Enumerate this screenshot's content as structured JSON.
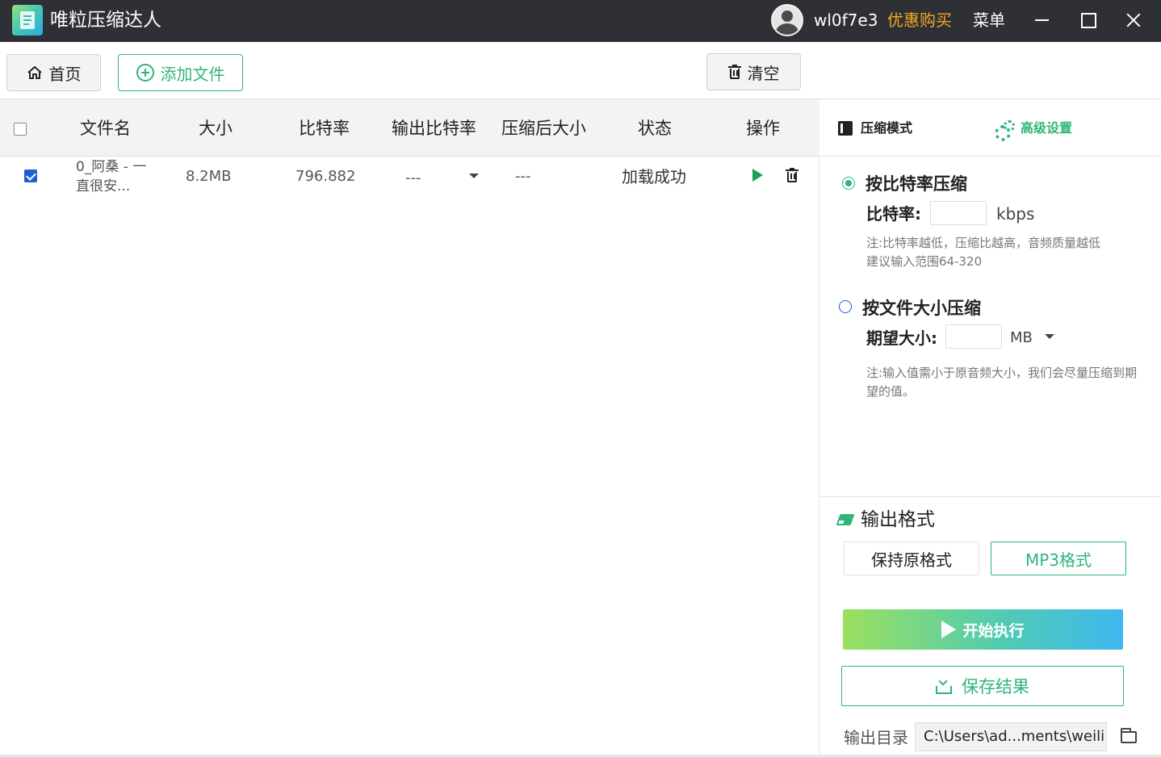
{
  "titlebar": {
    "app_name": "唯粒压缩达人",
    "username": "wl0f7e3",
    "promo_label": "优惠购买",
    "menu_label": "菜单"
  },
  "toolbar": {
    "home_label": "首页",
    "add_file_label": "添加文件",
    "clear_label": "清空"
  },
  "table": {
    "columns": [
      "文件名",
      "大小",
      "比特率",
      "输出比特率",
      "压缩后大小",
      "状态",
      "操作"
    ],
    "rows": [
      {
        "checked": true,
        "filename_line1": "0_阿桑 - 一",
        "filename_line2": "直很安...",
        "size": "8.2MB",
        "bitrate": "796.882",
        "output_bitrate": "---",
        "compressed_size": "---",
        "status": "加载成功"
      }
    ]
  },
  "panel": {
    "tab_mode_label": "压缩模式",
    "tab_advanced_label": "高级设置",
    "option_bitrate": {
      "title": "按比特率压缩",
      "selected": true,
      "field_label": "比特率:",
      "field_value": "",
      "unit": "kbps",
      "note_line1": "注:比特率越低，压缩比越高，音频质量越低",
      "note_line2": "建议输入范围64-320"
    },
    "option_size": {
      "title": "按文件大小压缩",
      "selected": false,
      "field_label": "期望大小:",
      "field_value": "",
      "unit": "MB",
      "note": "注:输入值需小于原音频大小，我们会尽量压缩到期望的值。"
    },
    "output_format": {
      "title": "输出格式",
      "keep_label": "保持原格式",
      "mp3_label": "MP3格式"
    },
    "start_label": "开始执行",
    "save_label": "保存结果",
    "output_dir_label": "输出目录",
    "output_dir_value": "C:\\Users\\ad...ments\\weili"
  },
  "colors": {
    "accent_green": "#2fb57b",
    "titlebar_bg": "#2e3035",
    "promo_orange": "#f5a623",
    "checkbox_blue": "#1d5fd1"
  }
}
